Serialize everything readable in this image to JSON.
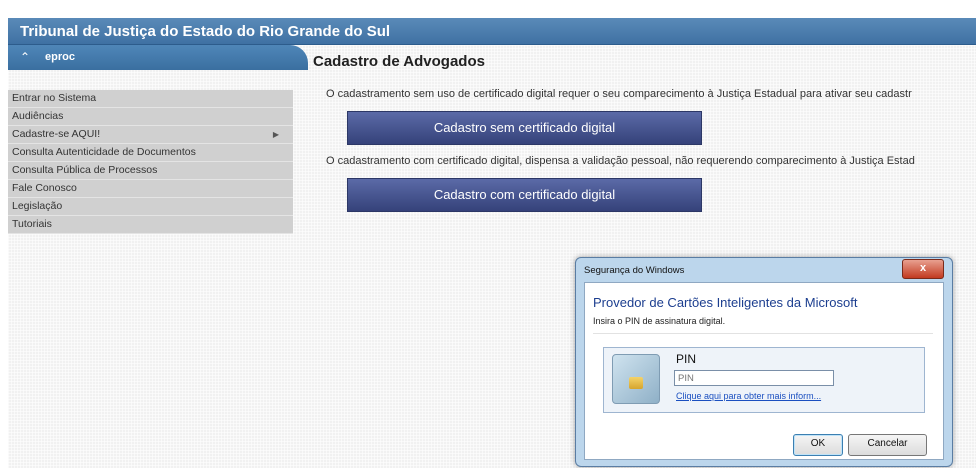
{
  "header": {
    "title": "Tribunal de Justiça do Estado do Rio Grande do Sul"
  },
  "sidebar": {
    "section_label": "eproc",
    "items": [
      {
        "label": "Entrar no Sistema"
      },
      {
        "label": "Audiências"
      },
      {
        "label": "Cadastre-se AQUI!"
      },
      {
        "label": "Consulta Autenticidade de Documentos"
      },
      {
        "label": "Consulta Pública de Processos"
      },
      {
        "label": "Fale Conosco"
      },
      {
        "label": "Legislação"
      },
      {
        "label": "Tutoriais"
      }
    ]
  },
  "main": {
    "title": "Cadastro de Advogados",
    "para_no_cert": "O cadastramento sem uso de certificado digital requer o seu comparecimento à Justiça Estadual para ativar seu cadastr",
    "btn_no_cert": "Cadastro sem certificado digital",
    "para_with_cert": "O cadastramento com certificado digital, dispensa a validação pessoal, não requerendo comparecimento à Justiça Estad",
    "btn_with_cert": "Cadastro com certificado digital"
  },
  "dialog": {
    "window_title": "Segurança do Windows",
    "close_glyph": "x",
    "heading": "Provedor de Cartões Inteligentes da Microsoft",
    "subtext": "Insira o PIN de assinatura digital.",
    "pin_label": "PIN",
    "pin_placeholder": "PIN",
    "info_link": "Clique aqui para obter mais inform...",
    "ok_label": "OK",
    "cancel_label": "Cancelar"
  },
  "icons": {
    "menu_collapse": "chevron-up-icon",
    "submenu": "chevron-right-icon",
    "smart_card": "smart-card-icon"
  }
}
